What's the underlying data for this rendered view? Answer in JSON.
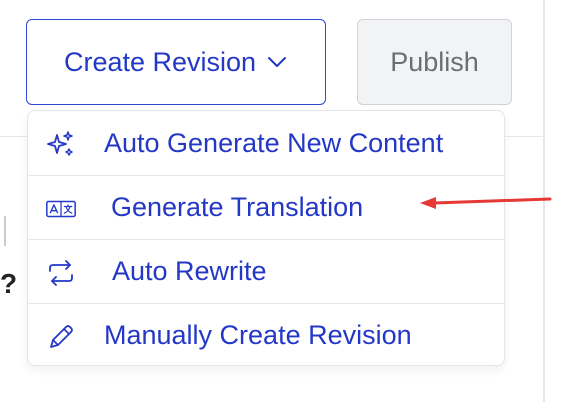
{
  "toolbar": {
    "create_label": "Create Revision",
    "publish_label": "Publish"
  },
  "menu": {
    "items": [
      {
        "label": "Auto Generate New Content",
        "icon": "sparkles-icon"
      },
      {
        "label": "Generate Translation",
        "icon": "translate-icon"
      },
      {
        "label": "Auto Rewrite",
        "icon": "repeat-icon"
      },
      {
        "label": "Manually Create Revision",
        "icon": "pencil-icon"
      }
    ]
  },
  "colors": {
    "accent": "#2338c7",
    "annotation_arrow": "#e53935"
  }
}
